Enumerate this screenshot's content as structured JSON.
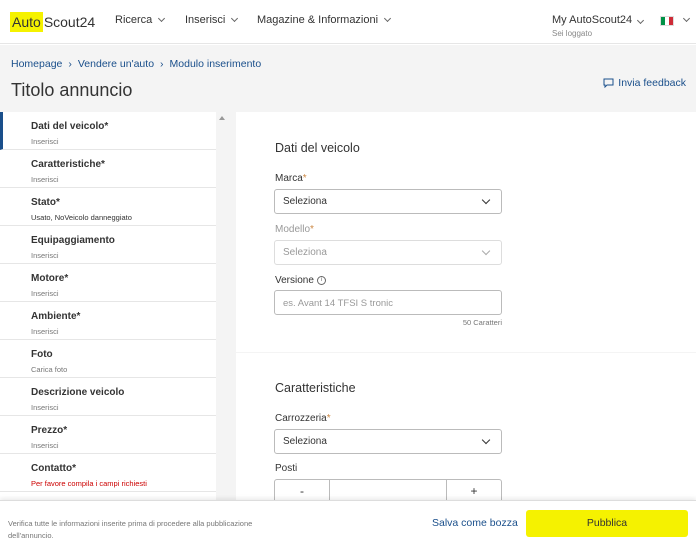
{
  "nav": {
    "logo_auto": "Auto",
    "logo_scout": "Scout24",
    "items": [
      "Ricerca",
      "Inserisci",
      "Magazine & Informazioni"
    ],
    "account": "My AutoScout24",
    "account_status": "Sei loggato",
    "flag_colors": [
      "#009246",
      "#ffffff",
      "#ce2b37"
    ]
  },
  "header": {
    "breadcrumb": [
      "Homepage",
      "Vendere un'auto",
      "Modulo inserimento"
    ],
    "title": "Titolo annuncio",
    "feedback": "Invia feedback"
  },
  "sidebar": {
    "items": [
      {
        "title": "Dati del veicolo*",
        "sub": "Inserisci"
      },
      {
        "title": "Caratteristiche*",
        "sub": "Inserisci"
      },
      {
        "title": "Stato*",
        "sub": "Usato, NoVeicolo danneggiato"
      },
      {
        "title": "Equipaggiamento",
        "sub": "Inserisci"
      },
      {
        "title": "Motore*",
        "sub": "Inserisci"
      },
      {
        "title": "Ambiente*",
        "sub": "Inserisci"
      },
      {
        "title": "Foto",
        "sub": "Carica foto"
      },
      {
        "title": "Descrizione veicolo",
        "sub": "Inserisci"
      },
      {
        "title": "Prezzo*",
        "sub": "Inserisci"
      },
      {
        "title": "Contatto*",
        "sub": "Per favore compila i campi richiesti"
      }
    ]
  },
  "vehicle": {
    "section_title": "Dati del veicolo",
    "brand_label": "Marca",
    "brand_value": "Seleziona",
    "model_label": "Modello",
    "model_value": "Seleziona",
    "version_label": "Versione",
    "version_placeholder": "es. Avant 14 TFSI S tronic",
    "version_counter": "50 Caratteri",
    "required_mark": "*"
  },
  "features": {
    "section_title": "Caratteristiche",
    "body_label": "Carrozzeria",
    "body_value": "Seleziona",
    "seats_label": "Posti",
    "minus": "-",
    "plus": "+"
  },
  "bottom": {
    "notice": "Verifica tutte le informazioni inserite prima di procedere alla pubblicazione dell'annuncio.",
    "save_draft": "Salva come bozza",
    "publish": "Pubblica"
  },
  "colors": {
    "accent_yellow": "#f5f200",
    "link_blue": "#1a4f8b",
    "error_red": "#cc0000"
  }
}
